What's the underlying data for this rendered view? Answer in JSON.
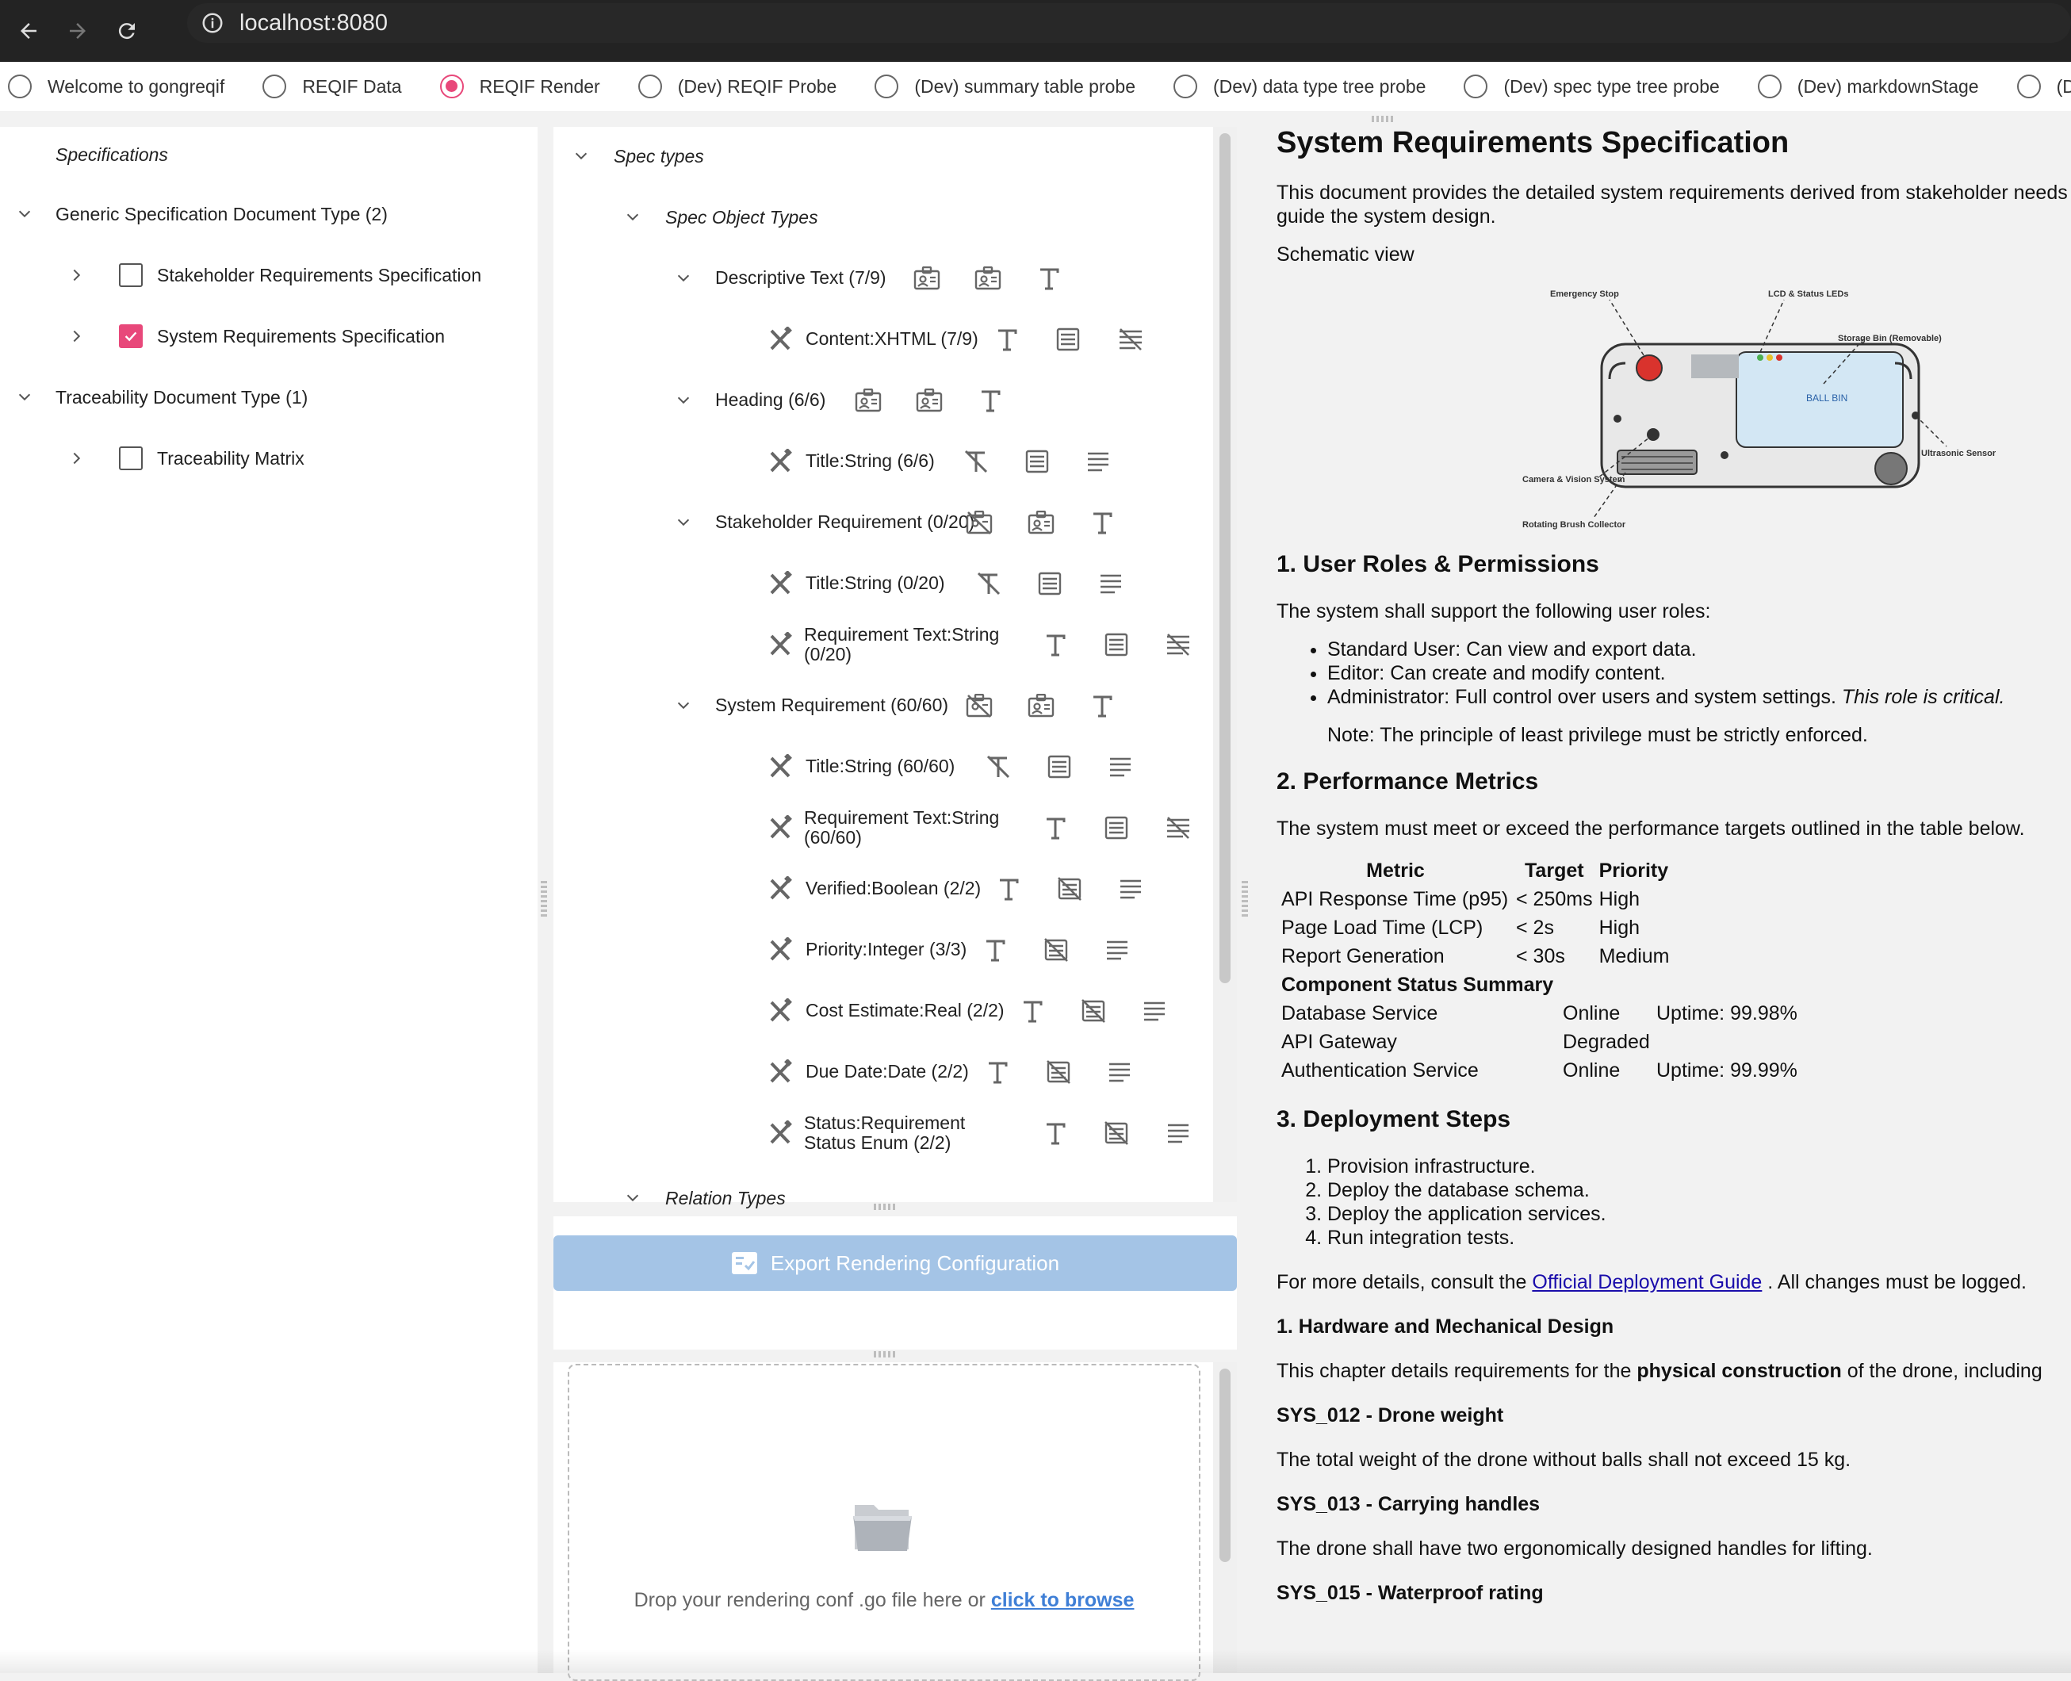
{
  "browser": {
    "url": "localhost:8080"
  },
  "tabs": [
    {
      "label": "Welcome to gongreqif",
      "selected": false
    },
    {
      "label": "REQIF Data",
      "selected": false
    },
    {
      "label": "REQIF Render",
      "selected": true
    },
    {
      "label": "(Dev) REQIF Probe",
      "selected": false
    },
    {
      "label": "(Dev) summary table probe",
      "selected": false
    },
    {
      "label": "(Dev) data type tree probe",
      "selected": false
    },
    {
      "label": "(Dev) spec type tree probe",
      "selected": false
    },
    {
      "label": "(Dev) markdownStage",
      "selected": false
    },
    {
      "label": "(D",
      "selected": false
    }
  ],
  "specs_tree": {
    "header": "Specifications",
    "groups": [
      {
        "label": "Generic Specification Document Type (2)",
        "items": [
          {
            "label": "Stakeholder Requirements Specification",
            "checked": false
          },
          {
            "label": "System Requirements Specification",
            "checked": true
          }
        ]
      },
      {
        "label": "Traceability Document Type (1)",
        "items": [
          {
            "label": "Traceability Matrix",
            "checked": false
          }
        ]
      }
    ]
  },
  "spec_types": {
    "header": "Spec types",
    "object_types_label": "Spec Object Types",
    "relation_types_label": "Relation Types",
    "types": [
      {
        "label": "Descriptive Text (7/9)",
        "attrs": [
          {
            "label": "Content:XHTML (7/9)"
          }
        ]
      },
      {
        "label": "Heading (6/6)",
        "attrs": [
          {
            "label": "Title:String (6/6)"
          }
        ]
      },
      {
        "label": "Stakeholder Requirement (0/20)",
        "attrs": [
          {
            "label": "Title:String (0/20)"
          },
          {
            "label": "Requirement Text:String (0/20)"
          }
        ]
      },
      {
        "label": "System Requirement (60/60)",
        "attrs": [
          {
            "label": "Title:String (60/60)"
          },
          {
            "label": "Requirement Text:String (60/60)"
          },
          {
            "label": "Verified:Boolean (2/2)"
          },
          {
            "label": "Priority:Integer (3/3)"
          },
          {
            "label": "Cost Estimate:Real (2/2)"
          },
          {
            "label": "Due Date:Date (2/2)"
          },
          {
            "label": "Status:Requirement Status Enum (2/2)"
          }
        ]
      }
    ]
  },
  "export": {
    "label": "Export Rendering Configuration"
  },
  "dropzone": {
    "text": "Drop your rendering conf .go file here or ",
    "link": " click to browse"
  },
  "document": {
    "title": "System Requirements Specification",
    "intro": "This document provides the detailed system requirements derived from stakeholder needs that will guide the system design.",
    "schematic_label": "Schematic view",
    "schematic_callouts": {
      "emergency": "Emergency Stop",
      "lcd": "LCD & Status LEDs",
      "storage": "Storage Bin (Removable)",
      "ballbin": "BALL BIN",
      "ultrasonic": "Ultrasonic Sensor",
      "camera": "Camera & Vision System",
      "brush": "Rotating Brush Collector"
    },
    "s1_title": "1. User Roles & Permissions",
    "s1_intro": "The system shall support the following user roles:",
    "roles": [
      "Standard User: Can view and export data.",
      "Editor: Can create and modify content.",
      "Administrator: Full control over users and system settings."
    ],
    "role_critical": "This role is critical.",
    "note": "Note: The principle of least privilege must be strictly enforced.",
    "s2_title": "2. Performance Metrics",
    "s2_intro": "The system must meet or exceed the performance targets outlined in the table below.",
    "perf_headers": [
      "Metric",
      "Target",
      "Priority"
    ],
    "perf_rows": [
      [
        "API Response Time (p95)",
        "< 250ms",
        "High"
      ],
      [
        "Page Load Time (LCP)",
        "< 2s",
        "High"
      ],
      [
        "Report Generation",
        "< 30s",
        "Medium"
      ]
    ],
    "status_title": "Component Status Summary",
    "status_rows": [
      [
        "Database Service",
        "Online",
        "Uptime: 99.98%"
      ],
      [
        "API Gateway",
        "Degraded",
        ""
      ],
      [
        "Authentication Service",
        "Online",
        "Uptime: 99.99%"
      ]
    ],
    "s3_title": "3. Deployment Steps",
    "steps": [
      "Provision infrastructure.",
      "Deploy the database schema.",
      "Deploy the application services.",
      "Run integration tests."
    ],
    "details_pre": "For more details, consult the ",
    "details_link": "Official Deployment Guide",
    "details_post": " . All changes must be logged.",
    "hw_title": "1. Hardware and Mechanical Design",
    "hw_pre": "This chapter details requirements for the ",
    "hw_bold": "physical construction",
    "hw_post": " of the drone, including",
    "req1_title": "SYS_012 - Drone weight",
    "req1_text": "The total weight of the drone without balls shall not exceed 15 kg.",
    "req2_title": "SYS_013 - Carrying handles",
    "req2_text": "The drone shall have two ergonomically designed handles for lifting.",
    "req3_title": "SYS_015 - Waterproof rating"
  }
}
